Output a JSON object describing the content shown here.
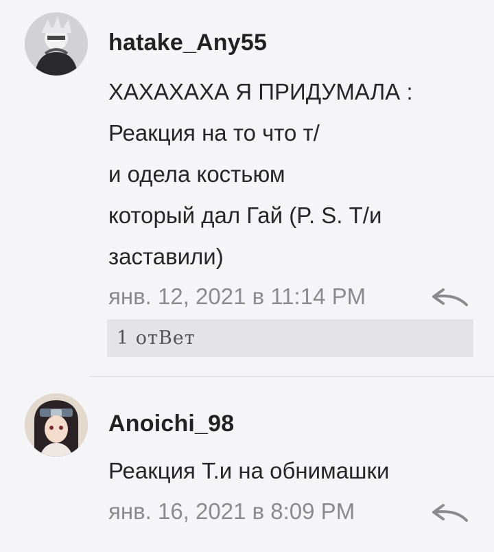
{
  "comments": [
    {
      "username": "hatake_Any55",
      "lines": [
        "ХАХАХАХА Я ПРИДУМАЛА :",
        "Реакция на то что т/",
        "и одела костьюм",
        "который дал Гай (P. S. Т/и",
        "заставили)"
      ],
      "timestamp": "янв. 12, 2021 в 11:14 PM",
      "replies_label": "1 отВет"
    },
    {
      "username": "Anoichi_98",
      "lines": [
        "Реакция Т.и на обнимашки"
      ],
      "timestamp": "янв. 16, 2021 в 8:09 PM"
    }
  ],
  "colors": {
    "background": "#f5f5f7",
    "meta": "#8b8b8f",
    "replies_bar": "#e4e4e7"
  },
  "icons": [
    "avatar",
    "reply-icon"
  ]
}
